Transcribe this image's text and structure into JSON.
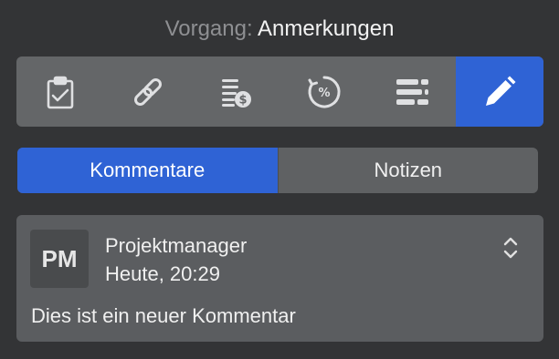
{
  "header": {
    "label": "Vorgang:",
    "value": "Anmerkungen"
  },
  "toolbar": {
    "tools": [
      {
        "icon": "clipboard-check-icon",
        "active": false
      },
      {
        "icon": "link-icon",
        "active": false
      },
      {
        "icon": "cost-list-icon",
        "active": false
      },
      {
        "icon": "progress-percent-icon",
        "active": false
      },
      {
        "icon": "list-lines-icon",
        "active": false
      },
      {
        "icon": "pencil-icon",
        "active": true
      }
    ]
  },
  "tabs": [
    {
      "label": "Kommentare",
      "active": true
    },
    {
      "label": "Notizen",
      "active": false
    }
  ],
  "comment": {
    "initials": "PM",
    "author": "Projektmanager",
    "time": "Heute, 20:29",
    "text": "Dies ist ein neuer Kommentar",
    "expand_icon": "chevron-up-down-icon"
  },
  "colors": {
    "accent": "#2f63d5",
    "background": "#333436"
  }
}
